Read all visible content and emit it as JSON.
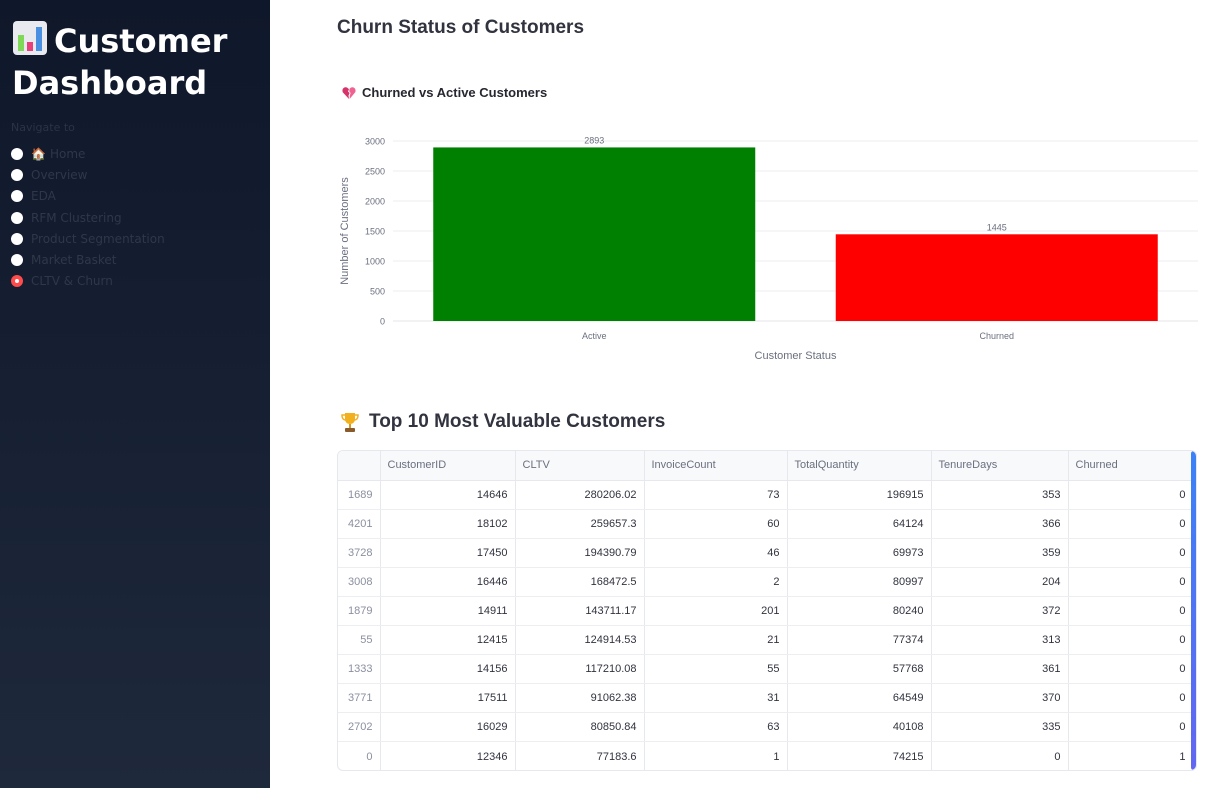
{
  "sidebar": {
    "title": "Customer Dashboard",
    "nav_caption": "Navigate to",
    "items": [
      {
        "label": "Home",
        "emoji": "🏠",
        "selected": false
      },
      {
        "label": "Overview",
        "selected": false
      },
      {
        "label": "EDA",
        "selected": false
      },
      {
        "label": "RFM Clustering",
        "selected": false
      },
      {
        "label": "Product Segmentation",
        "selected": false
      },
      {
        "label": "Market Basket",
        "selected": false
      },
      {
        "label": "CLTV & Churn",
        "selected": true
      }
    ]
  },
  "main": {
    "page_title": "Churn Status of Customers",
    "chart_heading": "Churned vs Active Customers",
    "table_heading": "Top 10 Most Valuable Customers"
  },
  "colors": {
    "active_bar": "#008000",
    "churned_bar": "#ff0000",
    "selected_radio": "#ff4b4b",
    "scrollbar": "#4f75f2"
  },
  "chart_data": {
    "type": "bar",
    "categories": [
      "Active",
      "Churned"
    ],
    "values": [
      2893,
      1445
    ],
    "data_labels": [
      "2893",
      "1445"
    ],
    "bar_colors": [
      "#008000",
      "#ff0000"
    ],
    "xlabel": "Customer Status",
    "ylabel": "Number of Customers",
    "ylim": [
      0,
      3000
    ],
    "yticks": [
      0,
      500,
      1000,
      1500,
      2000,
      2500,
      3000
    ],
    "grid": true
  },
  "table": {
    "columns": [
      "",
      "CustomerID",
      "CLTV",
      "InvoiceCount",
      "TotalQuantity",
      "TenureDays",
      "Churned"
    ],
    "rows": [
      [
        "1689",
        "14646",
        "280206.02",
        "73",
        "196915",
        "353",
        "0"
      ],
      [
        "4201",
        "18102",
        "259657.3",
        "60",
        "64124",
        "366",
        "0"
      ],
      [
        "3728",
        "17450",
        "194390.79",
        "46",
        "69973",
        "359",
        "0"
      ],
      [
        "3008",
        "16446",
        "168472.5",
        "2",
        "80997",
        "204",
        "0"
      ],
      [
        "1879",
        "14911",
        "143711.17",
        "201",
        "80240",
        "372",
        "0"
      ],
      [
        "55",
        "12415",
        "124914.53",
        "21",
        "77374",
        "313",
        "0"
      ],
      [
        "1333",
        "14156",
        "117210.08",
        "55",
        "57768",
        "361",
        "0"
      ],
      [
        "3771",
        "17511",
        "91062.38",
        "31",
        "64549",
        "370",
        "0"
      ],
      [
        "2702",
        "16029",
        "80850.84",
        "63",
        "40108",
        "335",
        "0"
      ],
      [
        "0",
        "12346",
        "77183.6",
        "1",
        "74215",
        "0",
        "1"
      ]
    ]
  }
}
